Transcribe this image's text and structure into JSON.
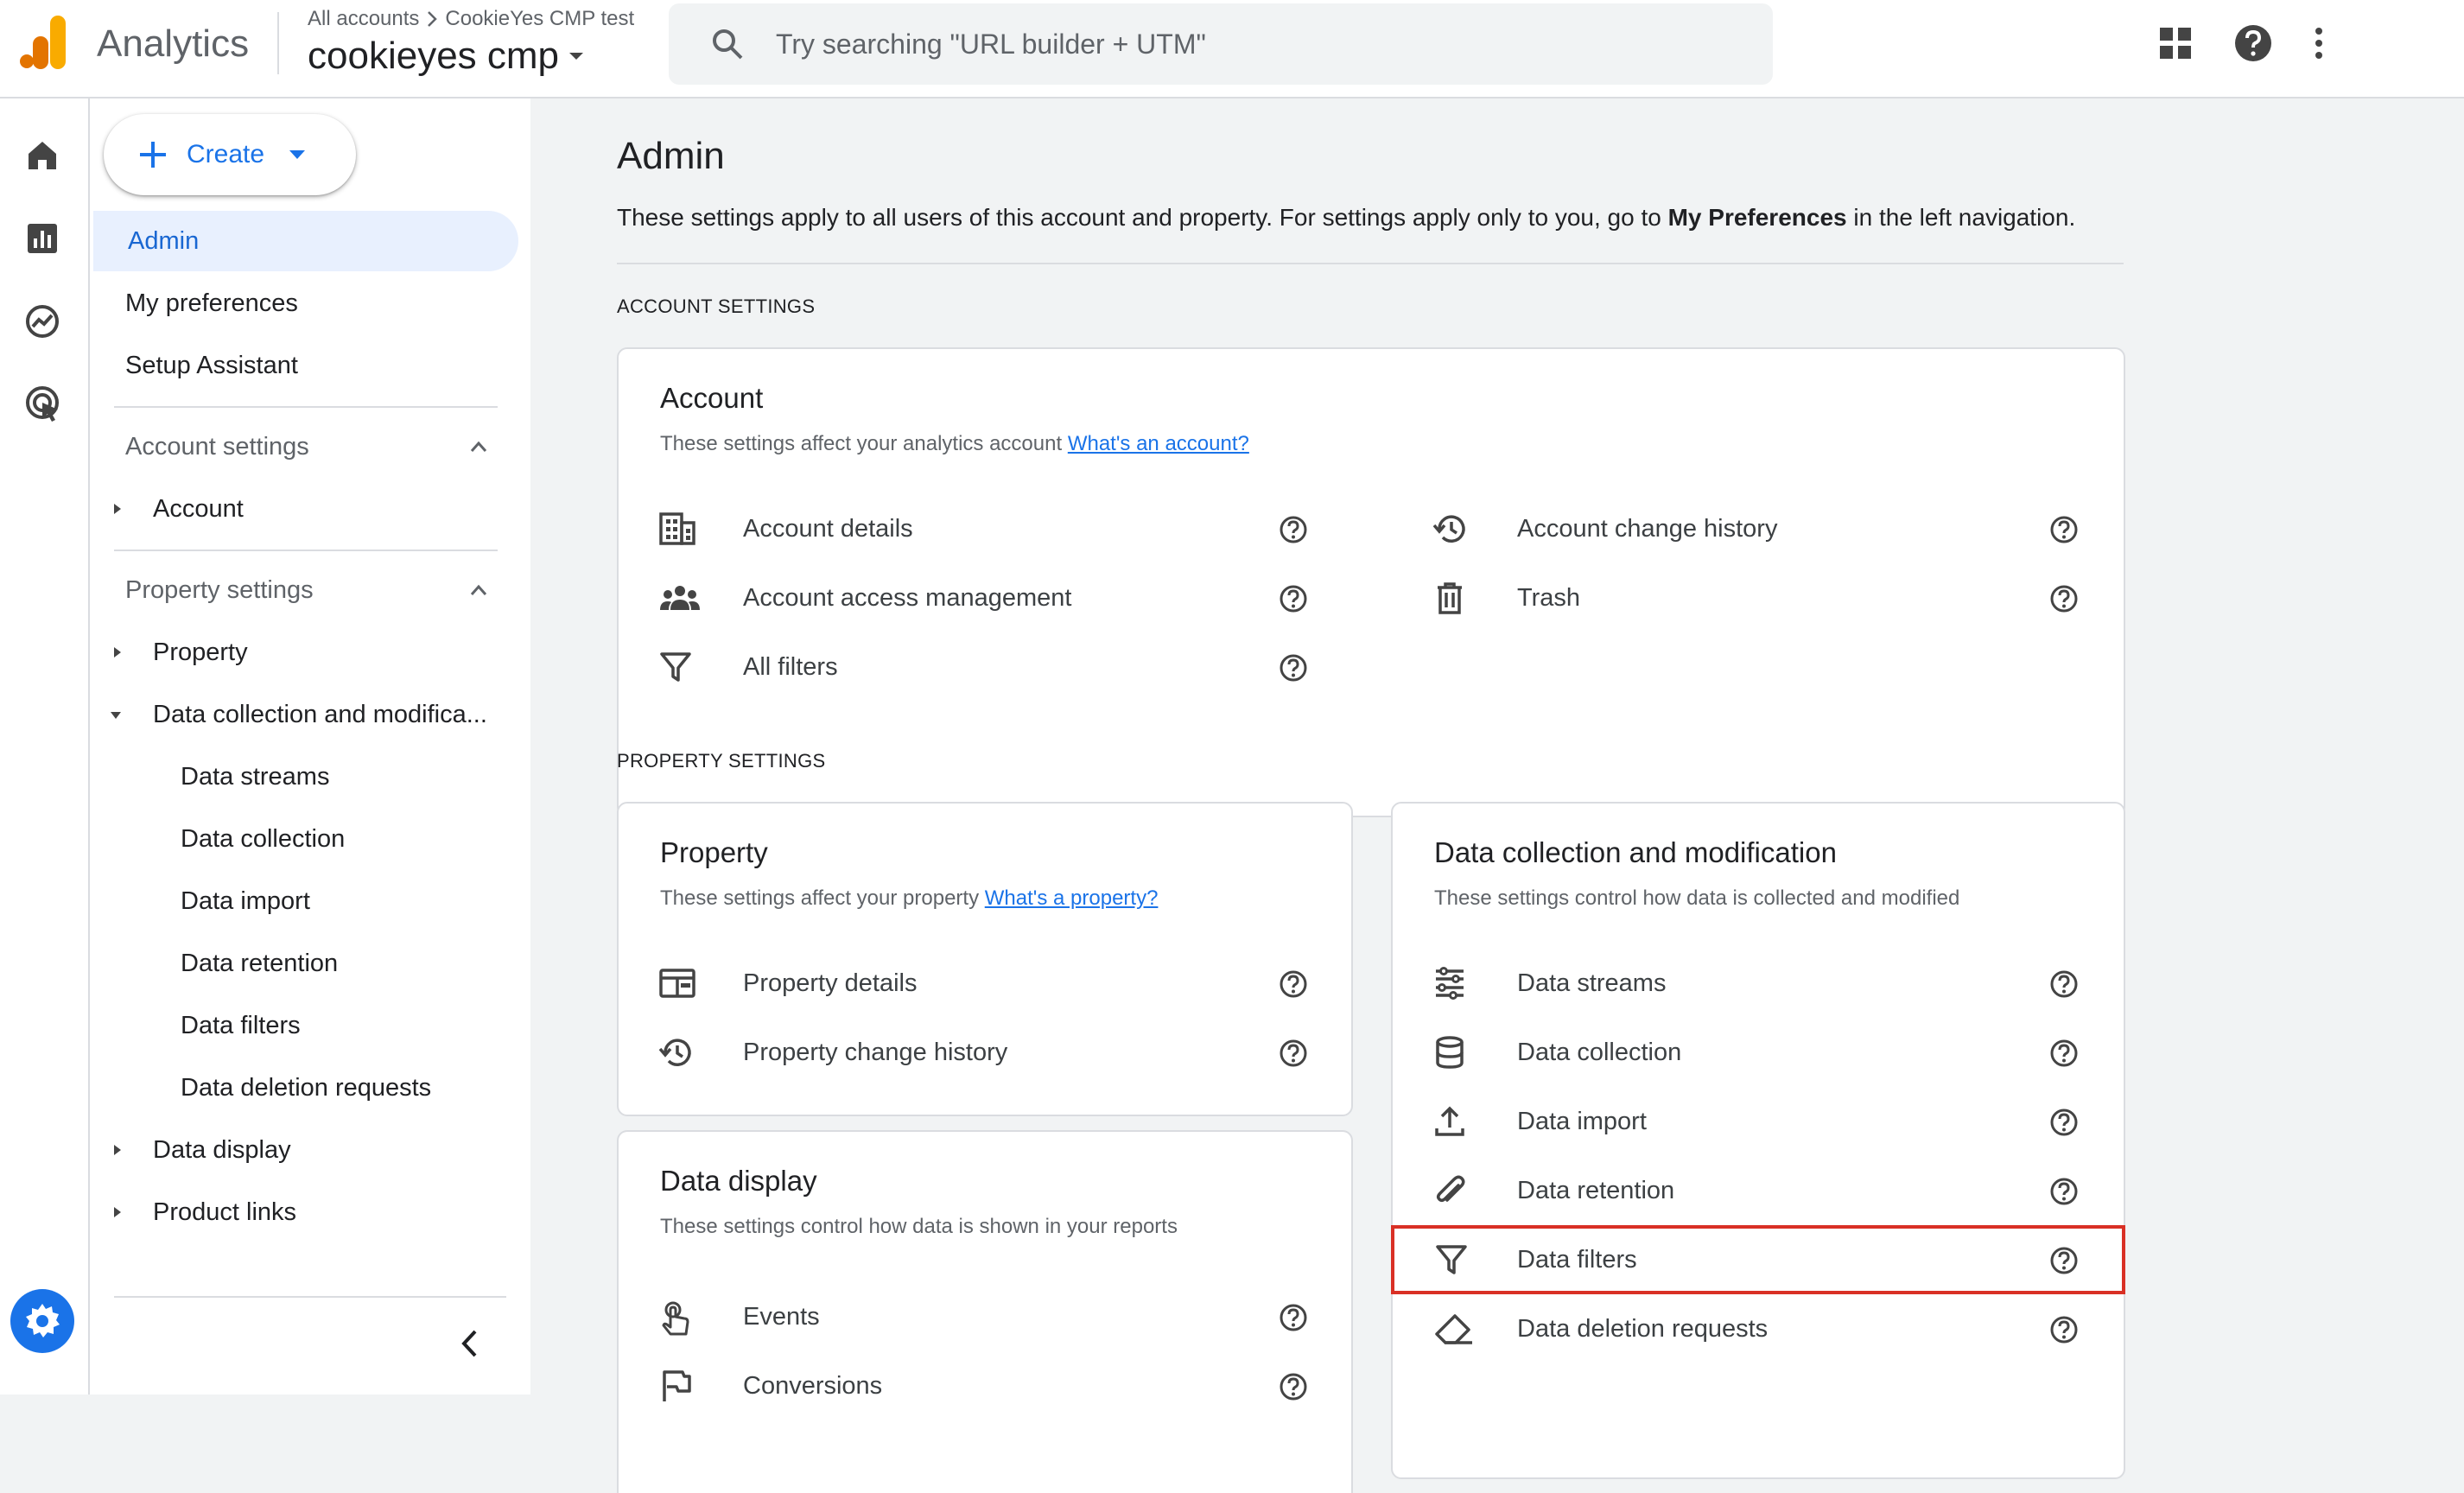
{
  "header": {
    "app_name": "Analytics",
    "breadcrumb_accounts": "All accounts",
    "breadcrumb_account": "CookieYes CMP test",
    "property_name": "cookieyes cmp",
    "search_placeholder": "Try searching \"URL builder + UTM\""
  },
  "nav": {
    "create_label": "Create",
    "items": {
      "admin": "Admin",
      "my_preferences": "My preferences",
      "setup_assistant": "Setup Assistant"
    },
    "account_settings": {
      "label": "Account settings",
      "account": "Account"
    },
    "property_settings": {
      "label": "Property settings",
      "property": "Property",
      "data_collection_modification": "Data collection and modifica...",
      "sub_items": [
        "Data streams",
        "Data collection",
        "Data import",
        "Data retention",
        "Data filters",
        "Data deletion requests"
      ],
      "data_display": "Data display",
      "product_links": "Product links"
    }
  },
  "main": {
    "title": "Admin",
    "description_start": "These settings apply to all users of this account and property. For settings apply only to you, go to ",
    "description_bold": "My Preferences",
    "description_end": " in the left navigation.",
    "account_section_label": "ACCOUNT SETTINGS",
    "property_section_label": "PROPERTY SETTINGS",
    "account_card": {
      "title": "Account",
      "subtitle": "These settings affect your analytics account ",
      "link": "What's an account?",
      "rows": {
        "account_details": "Account details",
        "account_access": "Account access management",
        "all_filters": "All filters",
        "change_history": "Account change history",
        "trash": "Trash"
      }
    },
    "property_card": {
      "title": "Property",
      "subtitle": "These settings affect your property ",
      "link": "What's a property?",
      "rows": {
        "property_details": "Property details",
        "property_change_history": "Property change history"
      }
    },
    "data_display_card": {
      "title": "Data display",
      "subtitle": "These settings control how data is shown in your reports",
      "rows": {
        "events": "Events",
        "conversions": "Conversions"
      }
    },
    "data_collection_card": {
      "title": "Data collection and modification",
      "subtitle": "These settings control how data is collected and modified",
      "rows": {
        "data_streams": "Data streams",
        "data_collection": "Data collection",
        "data_import": "Data import",
        "data_retention": "Data retention",
        "data_filters": "Data filters",
        "data_deletion": "Data deletion requests"
      }
    }
  },
  "colors": {
    "accent": "#1a73e8",
    "highlight": "#d93025",
    "logo_orange": "#f9ab00",
    "logo_dark_orange": "#e37400"
  }
}
